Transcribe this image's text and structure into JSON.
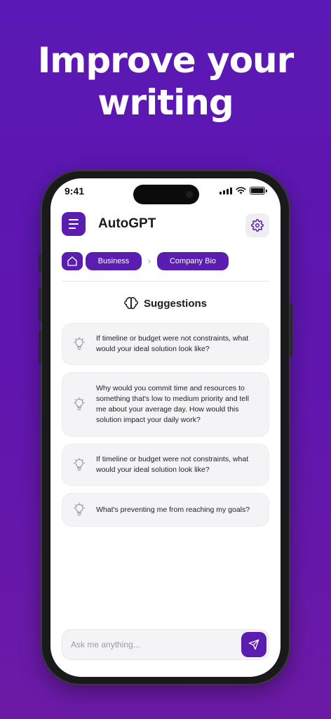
{
  "headline": {
    "line1": "Improve your",
    "line2": "writing"
  },
  "status_bar": {
    "time": "9:41"
  },
  "app": {
    "title": "AutoGPT"
  },
  "breadcrumb": {
    "items": [
      "Business",
      "Company Bio"
    ]
  },
  "suggestions": {
    "title": "Suggestions",
    "items": [
      "If timeline or budget were not constraints, what would your ideal solution look like?",
      "Why would you commit time and resources to something that's low to medium priority and tell me about your average day. How would this solution impact your daily work?",
      "If timeline or budget were not constraints, what would your ideal solution look like?",
      "What's preventing me from reaching my goals?"
    ]
  },
  "composer": {
    "placeholder": "Ask me anything..."
  },
  "colors": {
    "brand": "#5b1cb0",
    "background": "#5a18b4",
    "card": "#f4f4f7"
  }
}
